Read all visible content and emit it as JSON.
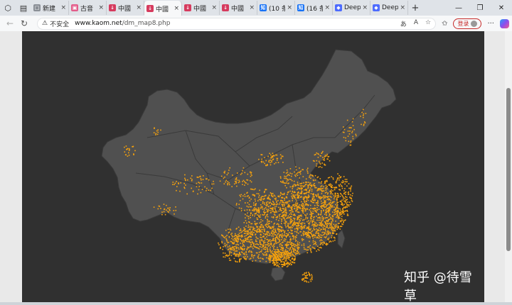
{
  "tabs": [
    {
      "label": "新建",
      "fav_color": "#8a8f96",
      "fav_glyph": "□",
      "active": false
    },
    {
      "label": "古音",
      "fav_color": "#e35d8a",
      "fav_glyph": "▣",
      "active": false
    },
    {
      "label": "中國",
      "fav_color": "#d63b5e",
      "fav_glyph": "↓",
      "active": false
    },
    {
      "label": "中國",
      "fav_color": "#d63b5e",
      "fav_glyph": "↓",
      "active": true
    },
    {
      "label": "中國",
      "fav_color": "#d63b5e",
      "fav_glyph": "↓",
      "active": false
    },
    {
      "label": "中國",
      "fav_color": "#d63b5e",
      "fav_glyph": "↓",
      "active": false
    },
    {
      "label": "(10 条",
      "fav_color": "#1772f6",
      "fav_glyph": "知",
      "active": false
    },
    {
      "label": "(16 条",
      "fav_color": "#1772f6",
      "fav_glyph": "知",
      "active": false
    },
    {
      "label": "Deep",
      "fav_color": "#4d6bfe",
      "fav_glyph": "◆",
      "active": false
    },
    {
      "label": "Deep",
      "fav_color": "#4d6bfe",
      "fav_glyph": "◆",
      "active": false
    }
  ],
  "address": {
    "security_label": "不安全",
    "host": "www.kaom.net",
    "path": "/dm_map8.php"
  },
  "toolbar": {
    "login_label": "登录",
    "more_label": "···"
  },
  "map": {
    "background": "#303030",
    "land_color": "#505050",
    "border_color": "#3a3a3a",
    "dot_color": "#f7a20c"
  },
  "watermark": {
    "text": "知乎 @待雪草"
  }
}
